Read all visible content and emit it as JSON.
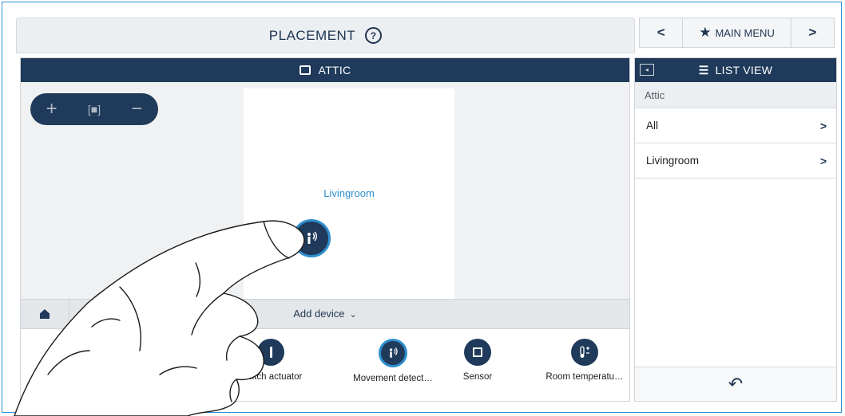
{
  "header": {
    "title": "PLACEMENT",
    "help_icon": "?"
  },
  "nav": {
    "prev": "<",
    "main_menu": "MAIN MENU",
    "next": ">"
  },
  "floor": {
    "title": "ATTIC"
  },
  "zoom": {
    "in": "+",
    "fit": "[■]",
    "out": "−"
  },
  "room": {
    "name": "Livingroom"
  },
  "add_device": {
    "label": "Add device",
    "chevron": "⌄"
  },
  "devices": [
    {
      "label": "Switch actuator",
      "icon": "switch-icon"
    },
    {
      "label": "Movement detect…",
      "icon": "motion-sensor-icon"
    },
    {
      "label": "Sensor",
      "icon": "sensor-icon"
    },
    {
      "label": "Room temperatu…",
      "icon": "thermometer-icon"
    }
  ],
  "list_view": {
    "title": "LIST VIEW",
    "breadcrumb": "Attic",
    "items": [
      {
        "label": "All"
      },
      {
        "label": "Livingroom"
      }
    ]
  },
  "colors": {
    "accent": "#2f8fcf",
    "dark": "#1f3a5a",
    "frame": "#2b8fd6"
  }
}
